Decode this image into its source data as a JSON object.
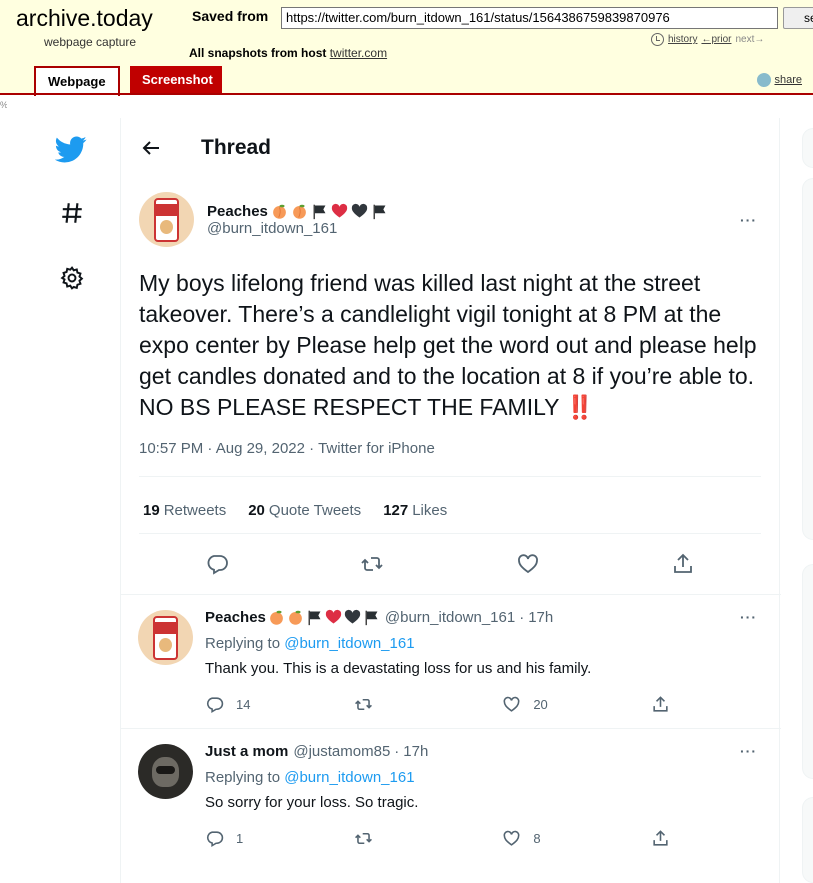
{
  "archive": {
    "brand": "archive.today",
    "brand_sub": "webpage capture",
    "saved_from_label": "Saved from",
    "url": "https://twitter.com/burn_itdown_161/status/1564386759839870976",
    "go_button": "se",
    "history": "history",
    "prior": "←prior",
    "next": "next→",
    "all_snapshots_label": "All snapshots",
    "from_host_label": "from host",
    "host": "twitter.com",
    "tab_webpage": "Webpage",
    "tab_screenshot": "Screenshot",
    "share": "share",
    "percent": "%"
  },
  "nav": {
    "icons": [
      "twitter-logo-icon",
      "explore-hashtag-icon",
      "settings-gear-icon"
    ],
    "brand_color": "#1d9bf0"
  },
  "thread": {
    "title": "Thread",
    "main_tweet": {
      "author_name": "Peaches",
      "author_emojis": [
        "peach",
        "peach",
        "black-flag",
        "red-heart",
        "black-heart",
        "black-flag"
      ],
      "handle": "@burn_itdown_161",
      "text": "My boys lifelong friend was killed last night at the street takeover. There’s a candlelight vigil tonight at 8 PM at the expo center by Please help get the word out and please help get candles donated and to the location at 8 if you’re able to. NO BS PLEASE RESPECT THE FAMILY",
      "trailing_emoji": "‼️",
      "time": "10:57 PM",
      "date": "Aug 29, 2022",
      "source": "Twitter for iPhone",
      "separator": "·",
      "retweets_count": "19",
      "retweets_label": "Retweets",
      "quotes_count": "20",
      "quotes_label": "Quote Tweets",
      "likes_count": "127",
      "likes_label": "Likes"
    },
    "replies": [
      {
        "author_name": "Peaches",
        "handle": "@burn_itdown_161",
        "age": "17h",
        "replying_label": "Replying to",
        "replying_to": "@burn_itdown_161",
        "text": "Thank you. This is a devastating loss for us and his family.",
        "reply_count": "14",
        "retweet_count": "",
        "like_count": "20"
      },
      {
        "author_name": "Just a mom",
        "handle": "@justamom85",
        "age": "17h",
        "replying_label": "Replying to",
        "replying_to": "@burn_itdown_161",
        "text": "So sorry for your loss. So tragic.",
        "reply_count": "1",
        "retweet_count": "",
        "like_count": "8"
      }
    ],
    "more_label": "···"
  }
}
